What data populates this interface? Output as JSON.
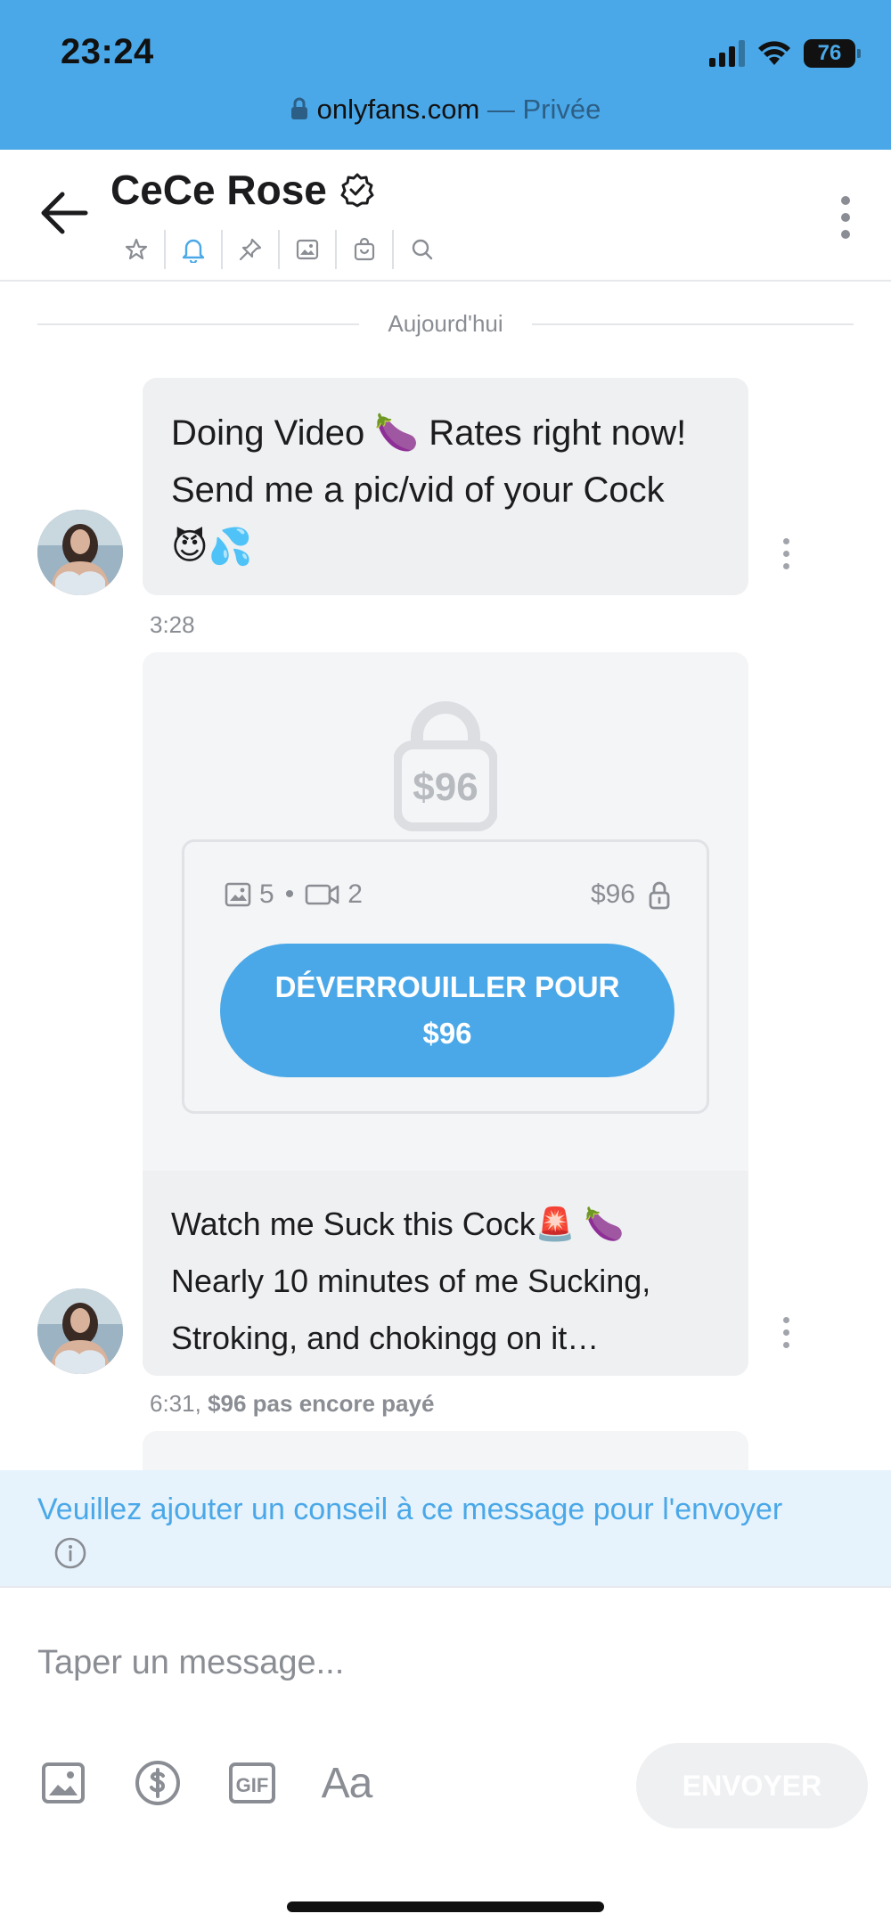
{
  "status_bar": {
    "time": "23:24",
    "battery": "76"
  },
  "url_bar": {
    "domain": "onlyfans.com",
    "separator": " — ",
    "mode": "Privée"
  },
  "header": {
    "name": "CeCe Rose",
    "tools": [
      "star-icon",
      "bell-icon",
      "pin-icon",
      "image-icon",
      "bag-icon",
      "search-icon"
    ]
  },
  "chat": {
    "date_divider": "Aujourd'hui",
    "messages": [
      {
        "text_line1": "Doing Video 🍆 Rates right now!",
        "text_line2": "Send me a pic/vid of your Cock",
        "text_line3": "😈💦",
        "time": "3:28"
      },
      {
        "lock_price": "$96",
        "photos": "5",
        "dot": "•",
        "videos": "2",
        "price": "$96",
        "unlock_line1": "DÉVERROUILLER POUR",
        "unlock_line2": "$96",
        "text_line1": "Watch me Suck this Cock🚨 🍆",
        "text_line2": "Nearly 10 minutes of me Sucking,",
        "text_line3": "Stroking, and chokingg on it…",
        "time": "6:31,",
        "status": "$96 pas encore payé"
      }
    ]
  },
  "tip_banner": {
    "text": "Veuillez ajouter un conseil à ce message pour l'envoyer"
  },
  "composer": {
    "placeholder": "Taper un message...",
    "text_style_label": "Aa",
    "send_label": "ENVOYER"
  },
  "colors": {
    "accent": "#4aa8e8",
    "bubble": "#eff0f2",
    "muted": "#8a8d93"
  }
}
